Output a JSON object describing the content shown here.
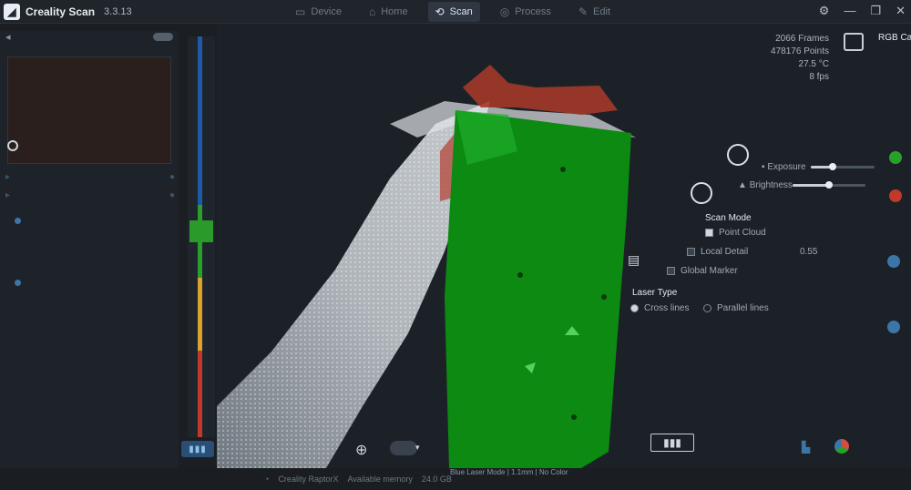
{
  "titlebar": {
    "app_name": "Creality Scan",
    "version": "3.3.13",
    "tabs": [
      {
        "label": "Device",
        "icon": "device-icon"
      },
      {
        "label": "Home",
        "icon": "home-icon"
      },
      {
        "label": "Scan",
        "icon": "scan-icon",
        "active": true
      },
      {
        "label": "Process",
        "icon": "process-icon"
      },
      {
        "label": "Edit",
        "icon": "edit-icon"
      }
    ]
  },
  "stats": {
    "frames": "2066 Frames",
    "points": "478176 Points",
    "temperature": "27.5 °C",
    "fps": "8 fps"
  },
  "camera_label": "RGB Camera",
  "settings": {
    "exposure_label": "Exposure",
    "exposure_level": 0.35,
    "brightness_label": "Brightness",
    "brightness_level": 0.5,
    "scan_mode_title": "Scan Mode",
    "point_cloud_label": "Point Cloud",
    "local_detail_label": "Local Detail",
    "local_detail_value": "0.55",
    "global_marker_label": "Global Marker",
    "laser_type_title": "Laser Type",
    "cross_lines_label": "Cross lines",
    "parallel_lines_label": "Parallel lines"
  },
  "status": {
    "device": "Creality RaptorX",
    "memory_label": "Available memory",
    "memory_value": "24.0 GB",
    "laser_info": "Blue Laser Mode | 1.1mm | No Color"
  },
  "colors": {
    "accent": "#2e3742",
    "scan_green": "#0c8a12",
    "point_white": "#d9dde2",
    "dist_red": "#c0392b",
    "dist_orange": "#d9a22a",
    "dist_green": "#2aa02a",
    "dist_blue": "#1f5aa8"
  }
}
